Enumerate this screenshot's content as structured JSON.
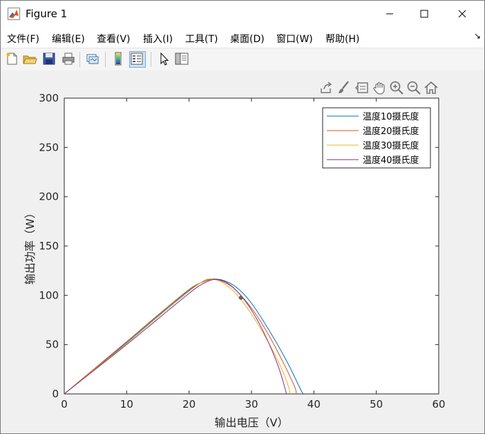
{
  "window": {
    "title": "Figure 1",
    "min_icon": "minimize-icon",
    "max_icon": "maximize-icon",
    "close_icon": "close-icon"
  },
  "menu": {
    "items": [
      {
        "label": "文件(F)"
      },
      {
        "label": "编辑(E)"
      },
      {
        "label": "查看(V)"
      },
      {
        "label": "插入(I)"
      },
      {
        "label": "工具(T)"
      },
      {
        "label": "桌面(D)"
      },
      {
        "label": "窗口(W)"
      },
      {
        "label": "帮助(H)"
      }
    ],
    "dock_glyph": "↘"
  },
  "toolbar": {
    "icons": [
      "new-figure-icon",
      "open-file-icon",
      "save-icon",
      "print-icon",
      "link-plot-icon",
      "colorbar-icon",
      "legend-icon",
      "select-pointer-icon",
      "property-inspector-icon"
    ]
  },
  "axes_toolbar": {
    "icons": [
      "export-icon",
      "brush-icon",
      "data-tips-icon",
      "pan-icon",
      "zoom-in-icon",
      "zoom-out-icon",
      "home-icon"
    ]
  },
  "chart_data": {
    "type": "line",
    "title": "",
    "xlabel": "输出电压（V）",
    "ylabel": "输出功率（W）",
    "xlim": [
      0,
      60
    ],
    "ylim": [
      0,
      300
    ],
    "xticks": [
      "0",
      "10",
      "20",
      "30",
      "40",
      "50",
      "60"
    ],
    "yticks": [
      "0",
      "50",
      "100",
      "150",
      "200",
      "250",
      "300"
    ],
    "grid": false,
    "legend_position": "top-right",
    "series": [
      {
        "name": "温度10摄氏度",
        "color": "#0072BD",
        "x": [
          0,
          5,
          10,
          15,
          20,
          22,
          24,
          26,
          28,
          30,
          32,
          34,
          36,
          37,
          38,
          38.3
        ],
        "y": [
          0,
          26,
          52,
          79,
          105,
          113,
          116.5,
          114,
          106,
          92,
          73,
          52,
          29,
          16,
          3,
          0
        ]
      },
      {
        "name": "温度20摄氏度",
        "color": "#D95319",
        "x": [
          0,
          5,
          10,
          15,
          20,
          22,
          23.5,
          25,
          27,
          29,
          31,
          33,
          35,
          36,
          37,
          37.2
        ],
        "y": [
          0,
          26.5,
          53,
          80,
          106,
          113,
          116.5,
          115,
          108,
          95,
          78,
          57,
          33,
          20,
          6,
          0
        ]
      },
      {
        "name": "温度30摄氏度",
        "color": "#EDB120",
        "x": [
          0,
          5,
          10,
          15,
          20,
          21.5,
          23,
          25,
          27,
          29,
          31,
          33,
          35,
          36,
          36.2
        ],
        "y": [
          0,
          25.5,
          51,
          78,
          104,
          111,
          116.5,
          114,
          105,
          90,
          71,
          49,
          23,
          6,
          0
        ]
      },
      {
        "name": "温度40摄氏度",
        "color": "#7E2F8E",
        "x": [
          0,
          5,
          10,
          15,
          20,
          22,
          24,
          26,
          28,
          30,
          32,
          34,
          35,
          35.6
        ],
        "y": [
          0,
          25,
          50,
          76,
          102,
          111,
          116,
          113,
          102,
          85,
          62,
          33,
          14,
          0
        ]
      }
    ],
    "marker": {
      "x": 28.3,
      "y": 97.5
    }
  }
}
